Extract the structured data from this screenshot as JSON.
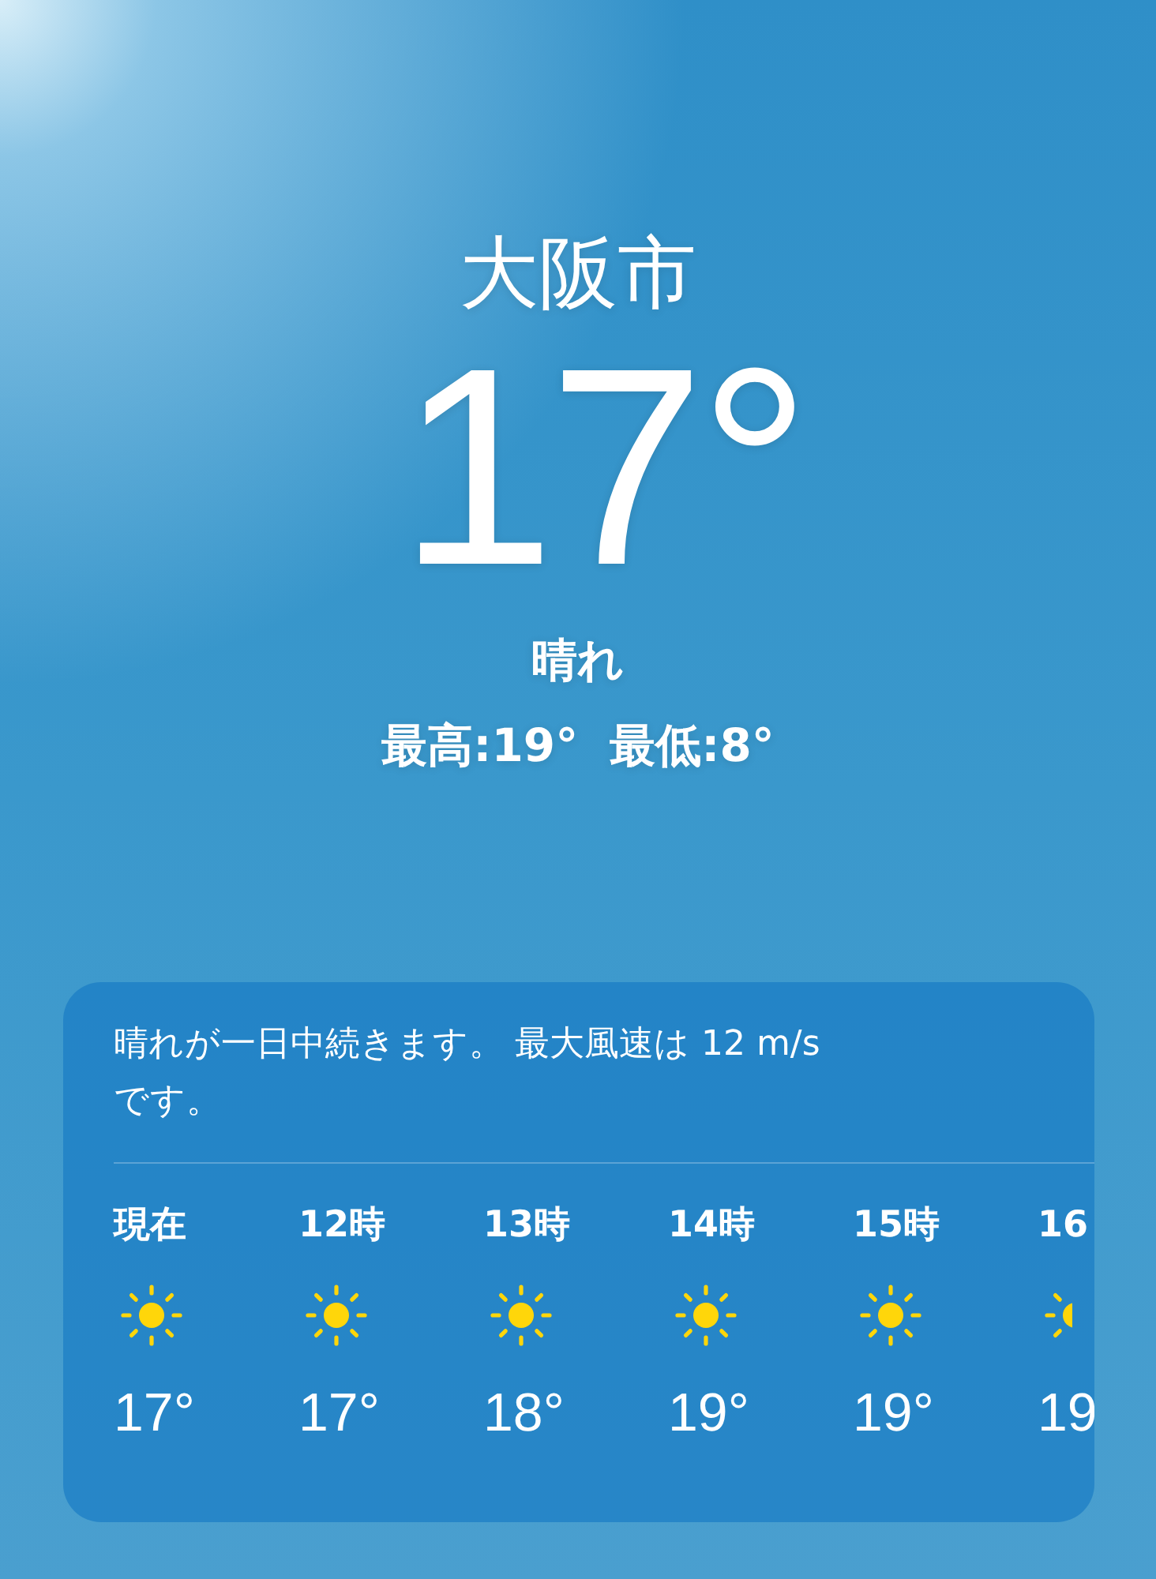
{
  "location": "大阪市",
  "temperature": "17°",
  "condition": "晴れ",
  "high": "最高:19°",
  "low": "最低:8°",
  "summary": "晴れが一日中続きます。 最大風速は 12 m/sです。",
  "hours": [
    {
      "label": "現在",
      "kind": "sunny",
      "temp": "17°"
    },
    {
      "label": "12時",
      "kind": "sunny",
      "temp": "17°"
    },
    {
      "label": "13時",
      "kind": "sunny",
      "temp": "18°"
    },
    {
      "label": "14時",
      "kind": "sunny",
      "temp": "19°"
    },
    {
      "label": "15時",
      "kind": "sunny",
      "temp": "19°"
    },
    {
      "label": "16",
      "kind": "sunny",
      "temp": "19"
    }
  ]
}
